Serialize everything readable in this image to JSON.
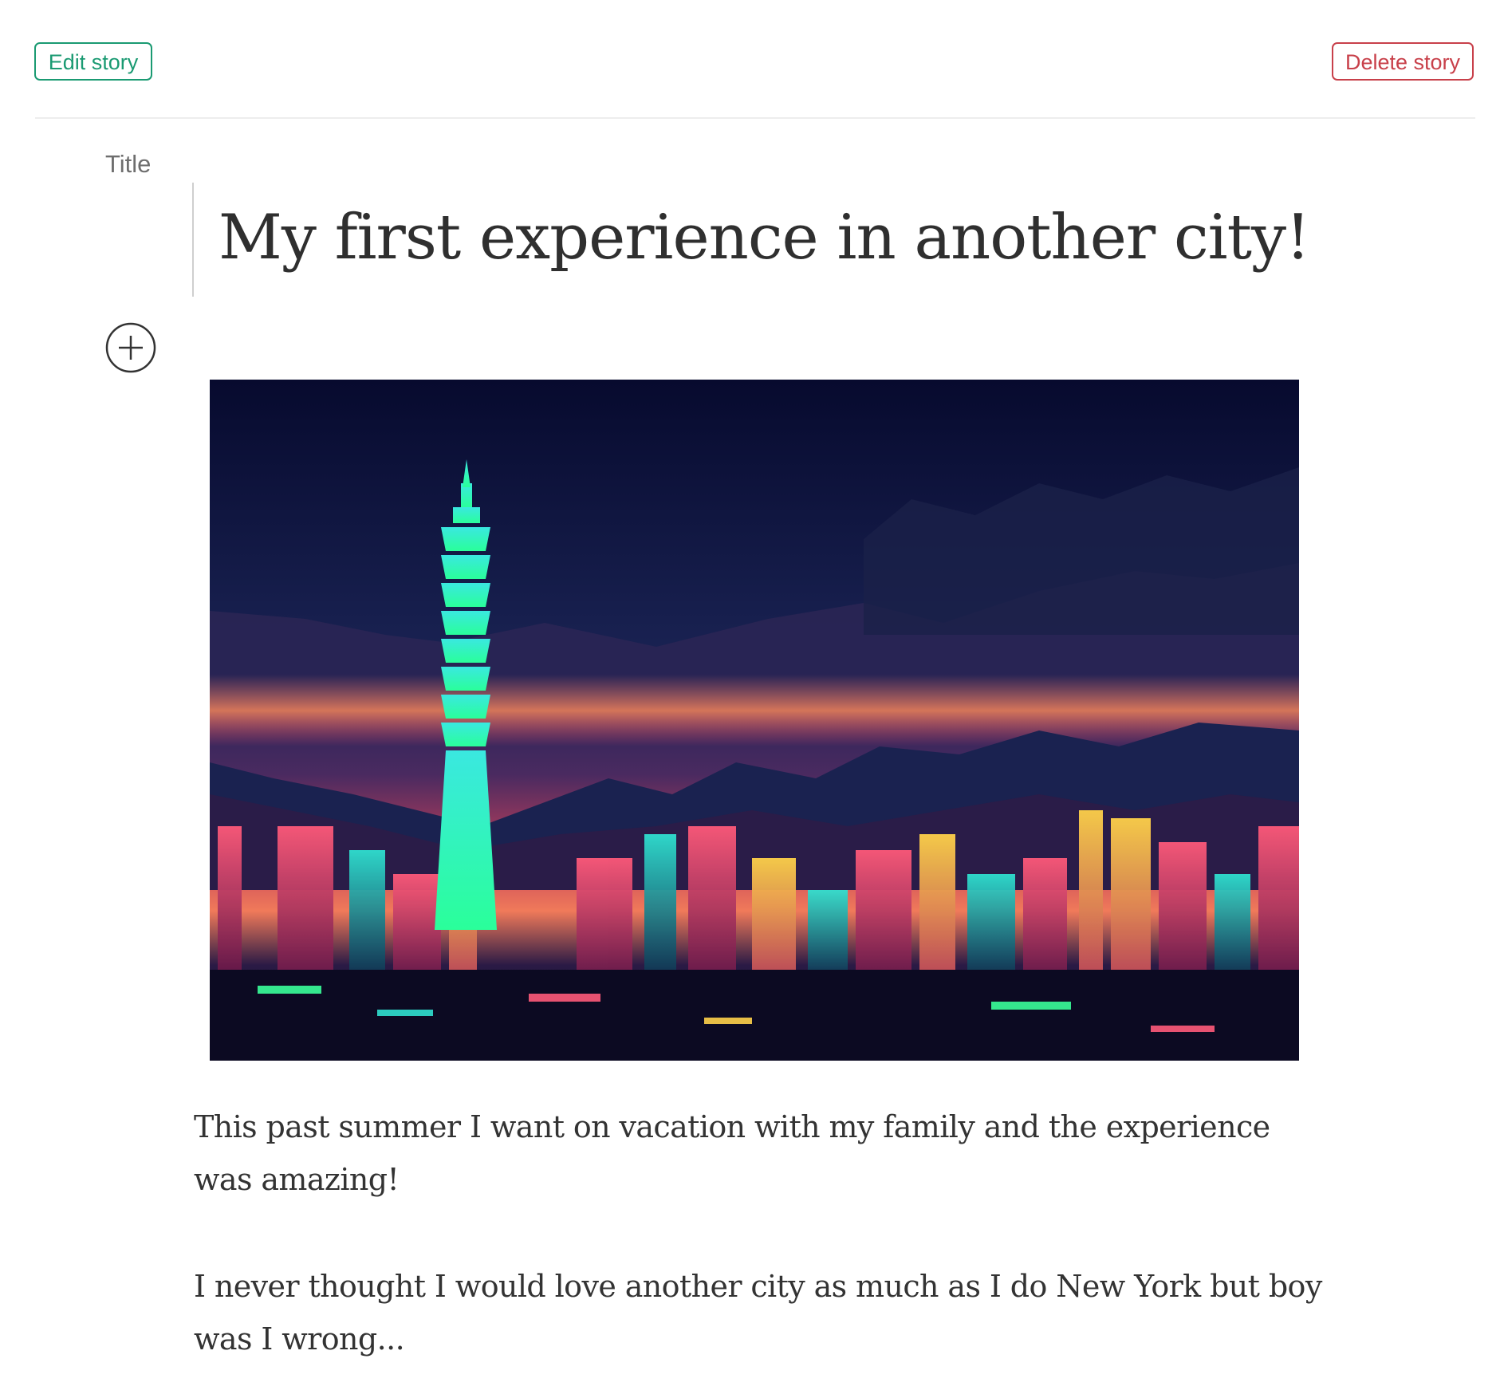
{
  "toolbar": {
    "edit_label": "Edit story",
    "delete_label": "Delete story"
  },
  "editor": {
    "title_label": "Title",
    "title": "My first experience in another city!",
    "add_icon": "plus-circle-icon",
    "image_alt": "Neon illustration of a city skyline at night with a tall tower",
    "paragraphs": [
      "This past summer I want on vacation with my family and the experience was amazing!",
      "I never thought I would love another city as much as I do New York but boy was I wrong..."
    ]
  },
  "colors": {
    "edit_accent": "#1a9a72",
    "delete_accent": "#c8404a",
    "text": "#333333"
  }
}
